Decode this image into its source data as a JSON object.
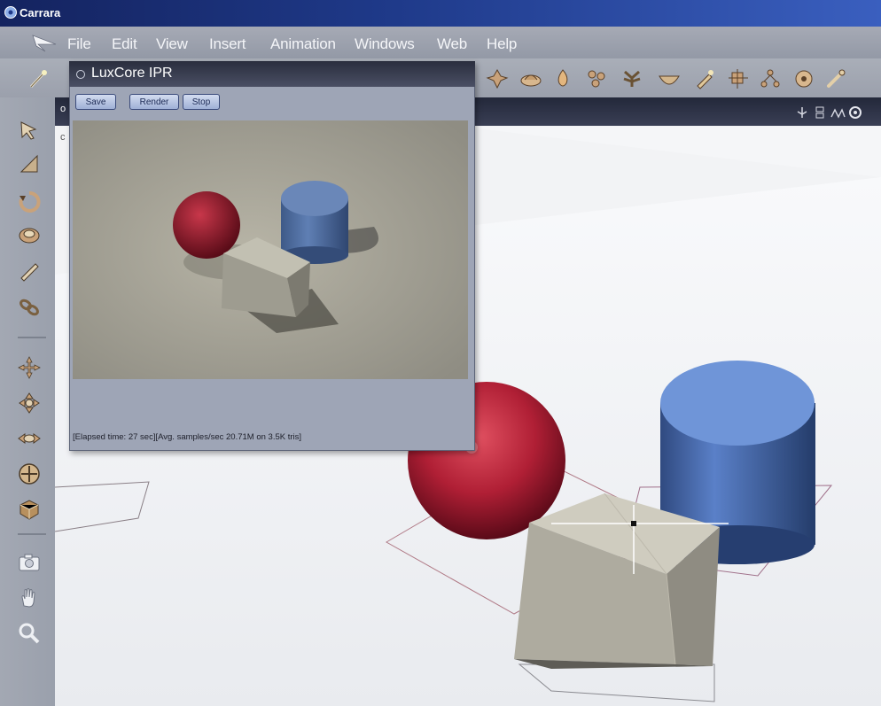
{
  "app": {
    "title": "Carrara"
  },
  "menu": {
    "items": [
      "File",
      "Edit",
      "View",
      "Insert",
      "Animation",
      "Windows",
      "Web",
      "Help"
    ]
  },
  "ipr": {
    "title": "LuxCore IPR",
    "buttons": {
      "save": "Save",
      "render": "Render",
      "stop": "Stop"
    },
    "status": "[Elapsed time:  27 sec][Avg. samples/sec  20.71M on 3.5K tris]"
  },
  "viewport": {
    "label_top": "o",
    "label_corner": "c"
  },
  "colors": {
    "titlebar": "#1f3a8a",
    "menu_text": "#f4f5f8",
    "ipr_bg": "#9ea5b6",
    "button_text": "#1c2a55"
  },
  "icons": {
    "toolbar": [
      "wand-icon",
      "joint-icon",
      "terrain-icon",
      "fire-icon",
      "particles-icon",
      "plant-icon",
      "bowl-icon",
      "torch-icon",
      "camera-rig-icon",
      "hierarchy-icon",
      "target-icon",
      "bone-icon"
    ],
    "left": [
      "select-arrow-icon",
      "move-plane-icon",
      "rotate-icon",
      "rotate-trackball-icon",
      "pen-icon",
      "link-icon",
      "move-xy-icon",
      "move-xz-icon",
      "move-yz-icon",
      "move-3d-icon",
      "scale-box-icon",
      "camera-icon",
      "hand-icon",
      "zoom-icon"
    ]
  }
}
